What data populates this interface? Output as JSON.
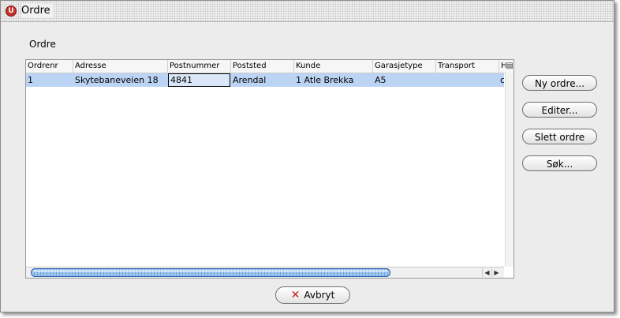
{
  "window": {
    "title": "Ordre",
    "app_icon_glyph": "U"
  },
  "section_label": "Ordre",
  "table": {
    "columns": [
      "Ordrenr",
      "Adresse",
      "Postnummer",
      "Poststed",
      "Kunde",
      "Garasjetype",
      "Transport",
      "H"
    ],
    "rows": [
      {
        "Ordrenr": "1",
        "Adresse": "Skytebaneveien 18",
        "Postnummer": "4841",
        "Poststed": "Arendal",
        "Kunde": "1 Atle Brekka",
        "Garasjetype": "A5",
        "Transport": "",
        "H": "c"
      }
    ],
    "selected_row_color": "#bcd4f4"
  },
  "buttons": {
    "new": "Ny ordre...",
    "edit": "Editer...",
    "delete": "Slett ordre",
    "search": "Søk..."
  },
  "cancel_button": {
    "label": "Avbryt",
    "icon": "x-icon"
  },
  "colors": {
    "accent": "#6fa4de",
    "cancel_icon": "#c8201a"
  }
}
